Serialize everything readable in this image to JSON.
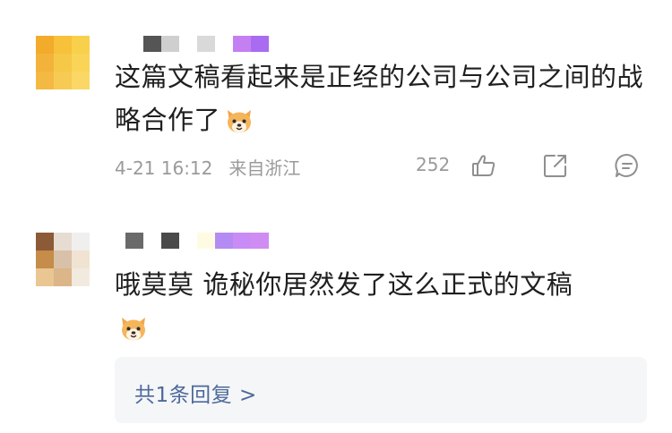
{
  "comments": [
    {
      "text": "这篇文稿看起来是正经的公司与公司之间的战略合作了",
      "emoji": "dog-face-emoji",
      "time": "4-21 16:12",
      "location": "来自浙江",
      "likes": "252",
      "avatar_colors": [
        "#f2ab2a",
        "#f7c13a",
        "#f9d04c",
        "#f3b33a",
        "#f6c848",
        "#f9d457",
        "#f4b942",
        "#f7ca53",
        "#fbd866"
      ],
      "name_mosaic_colors": [
        "#555555",
        "#cfcfcf",
        "#ffffff",
        "#d9d9d9",
        "#ffffff",
        "#c47ff2",
        "#a96cf0"
      ]
    },
    {
      "text": "哦莫莫 诡秘你居然发了这么正式的文稿",
      "emoji": "dog-face-emoji",
      "avatar_colors": [
        "#8c5a36",
        "#e7dcd2",
        "#f1efee",
        "#c58c4a",
        "#d8c1a8",
        "#f0e3d2",
        "#e9c692",
        "#dcb588",
        "#f2eadf"
      ],
      "name_mosaic_colors": [
        "#6a6a6a",
        "#ffffff",
        "#4a4a4a",
        "#ffffff",
        "#fffbe3",
        "#b38bf3",
        "#c98cf7",
        "#cf8cf3"
      ],
      "replies_label": "共1条回复 >"
    }
  ],
  "colors": {
    "meta_gray": "#9a9a9a",
    "link_blue": "#4d6a9a",
    "reply_bg": "#f5f6f8"
  },
  "icons": [
    "thumbs-up-icon",
    "share-icon",
    "comment-icon"
  ]
}
